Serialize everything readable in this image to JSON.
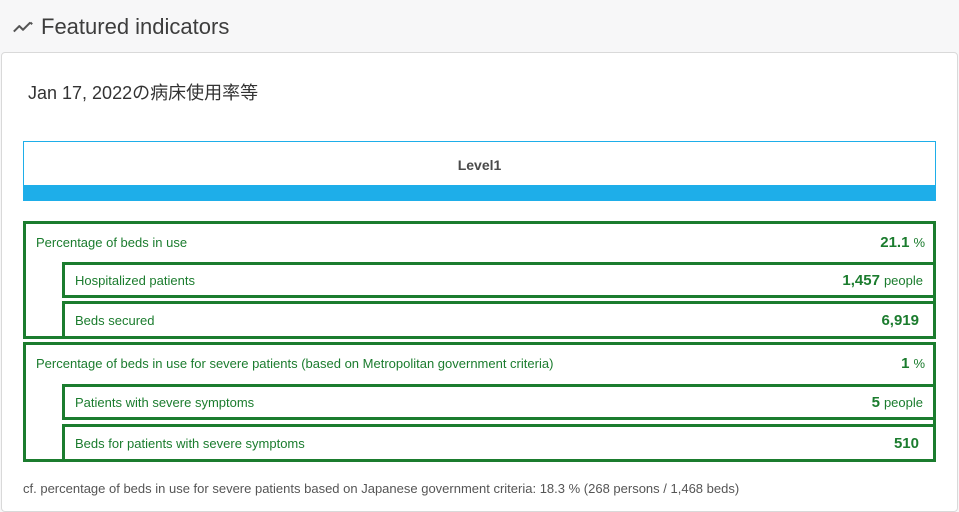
{
  "header": {
    "title": "Featured indicators",
    "icon": "trend-line-icon"
  },
  "card": {
    "subtitle": "Jan 17, 2022の病床使用率等",
    "level": {
      "label": "Level1",
      "color": "#1eaee9"
    },
    "groups": [
      {
        "label": "Percentage of beds in use",
        "value": "21.1",
        "unit": "%",
        "children": [
          {
            "label": "Hospitalized patients",
            "value": "1,457",
            "unit": "people"
          },
          {
            "label": "Beds secured",
            "value": "6,919",
            "unit": ""
          }
        ]
      },
      {
        "label": "Percentage of beds in use for severe patients (based on Metropolitan government criteria)",
        "value": "1",
        "unit": "%",
        "children": [
          {
            "label": "Patients with severe symptoms",
            "value": "5",
            "unit": "people"
          },
          {
            "label": "Beds for patients with severe symptoms",
            "value": "510",
            "unit": ""
          }
        ]
      }
    ],
    "footnote": "cf. percentage of beds in use for severe patients based on Japanese government criteria: 18.3 % (268 persons / 1,468 beds)"
  },
  "colors": {
    "green": "#1b7c2e",
    "blue": "#1eaee9"
  }
}
